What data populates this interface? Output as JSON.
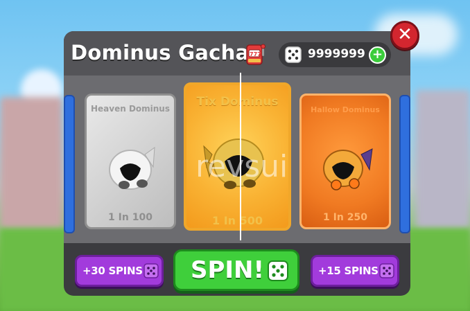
{
  "header": {
    "title": "Dominus Gacha",
    "currency_value": "9999999",
    "slot_icon": "slot-machine-icon",
    "currency_icon": "dice-icon"
  },
  "cards": [
    {
      "name": "Heaven Dominus",
      "odds": "1 In 100",
      "theme": "silver"
    },
    {
      "name": "Tix Dominus",
      "odds": "1 In 500",
      "theme": "gold"
    },
    {
      "name": "Hallow Dominus",
      "odds": "1 In 250",
      "theme": "orange"
    }
  ],
  "controls": {
    "buy_left_label": "+30 SPINS",
    "spin_label": "SPIN!",
    "buy_right_label": "+15 SPINS"
  },
  "overlay": {
    "watermark": "revsui"
  },
  "colors": {
    "spin": "#3fcf3b",
    "buy": "#a23bdc",
    "close": "#d3262f",
    "panel": "#3b3b3f"
  }
}
